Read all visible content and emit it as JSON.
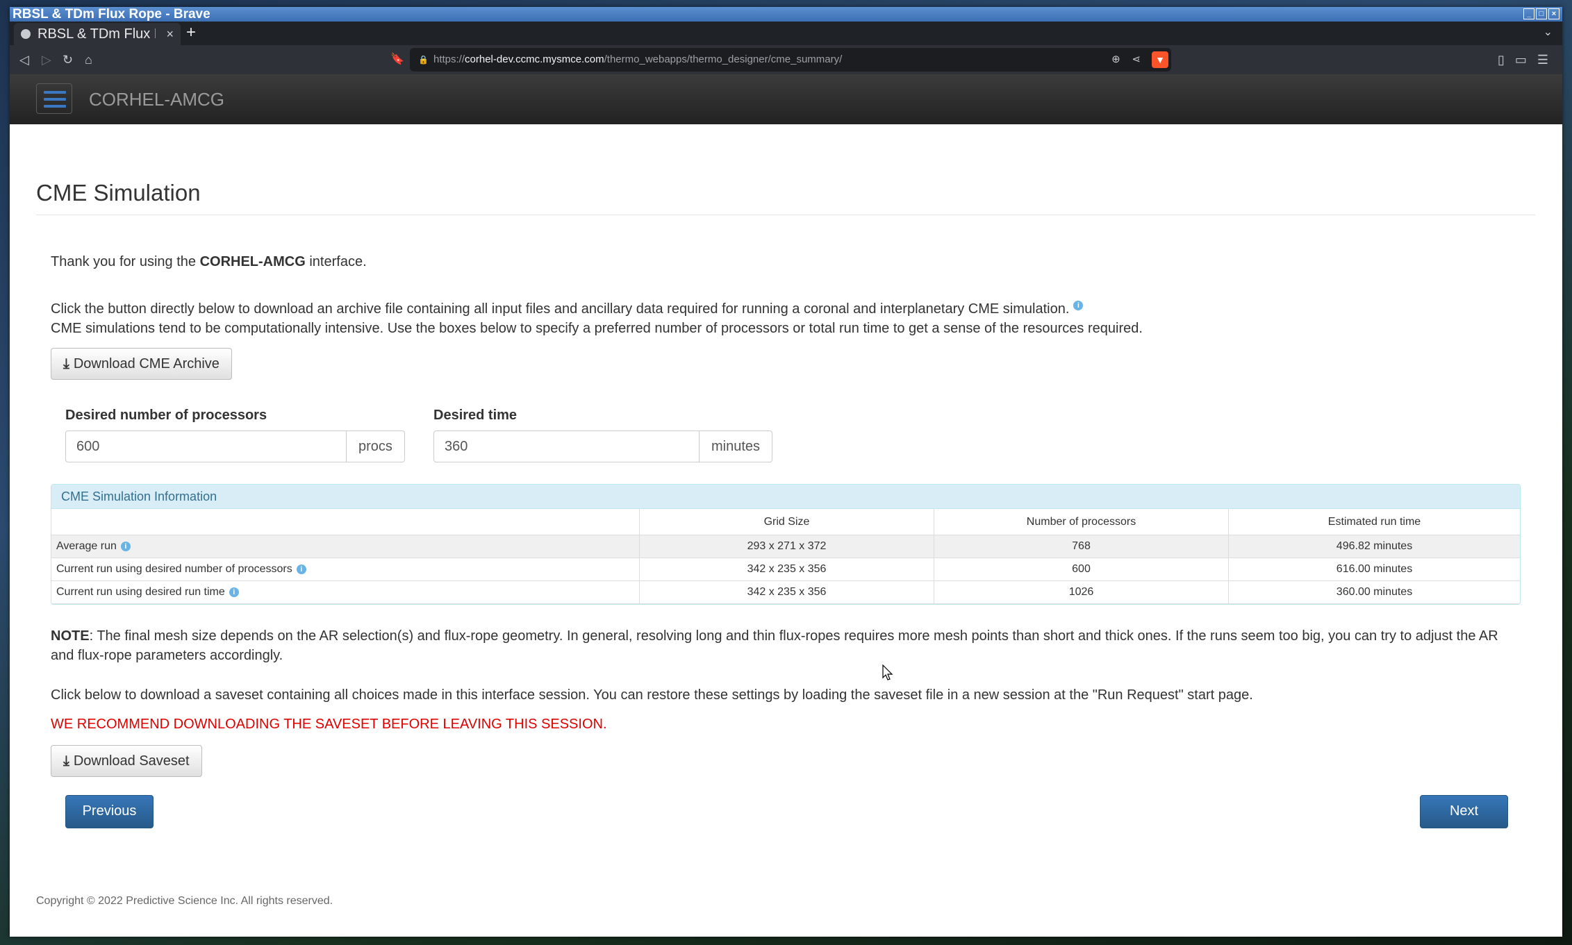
{
  "window": {
    "title": "RBSL & TDm Flux Rope - Brave"
  },
  "tab": {
    "label": "RBSL & TDm Flux Rope"
  },
  "url": {
    "host": "corhel-dev.ccmc.mysmce.com",
    "path": "/thermo_webapps/thermo_designer/cme_summary/",
    "scheme": "https://"
  },
  "navbar": {
    "brand": "CORHEL-AMCG"
  },
  "page": {
    "title": "CME Simulation",
    "thanks_pre": "Thank you for using the ",
    "thanks_bold": "CORHEL-AMCG",
    "thanks_post": " interface.",
    "intro1": "Click the button directly below to download an archive file containing all input files and ancillary data required for running a coronal and interplanetary CME simulation.",
    "intro2": "CME simulations tend to be computationally intensive. Use the boxes below to specify a preferred number of processors or total run time to get a sense of the resources required.",
    "download_archive": "Download CME Archive",
    "procs_label": "Desired number of processors",
    "procs_value": "600",
    "procs_unit": "procs",
    "time_label": "Desired time",
    "time_value": "360",
    "time_unit": "minutes",
    "note_bold": "NOTE",
    "note_text": ": The final mesh size depends on the AR selection(s) and flux-rope geometry. In general, resolving long and thin flux-ropes requires more mesh points than short and thick ones. If the runs seem too big, you can try to adjust the AR and flux-rope parameters accordingly.",
    "saveset_text": "Click below to download a saveset containing all choices made in this interface session. You can restore these settings by loading the saveset file in a new session at the \"Run Request\" start page.",
    "warning": "WE RECOMMEND DOWNLOADING THE SAVESET BEFORE LEAVING THIS SESSION.",
    "download_saveset": "Download Saveset",
    "previous": "Previous",
    "next": "Next",
    "footer": "Copyright © 2022 Predictive Science Inc. All rights reserved."
  },
  "info_panel": {
    "heading": "CME Simulation Information",
    "columns": [
      "",
      "Grid Size",
      "Number of processors",
      "Estimated run time"
    ],
    "rows": [
      {
        "label": "Average run",
        "grid": "293 x 271 x 372",
        "procs": "768",
        "time": "496.82 minutes"
      },
      {
        "label": "Current run using desired number of processors",
        "grid": "342 x 235 x 356",
        "procs": "600",
        "time": "616.00 minutes"
      },
      {
        "label": "Current run using desired run time",
        "grid": "342 x 235 x 356",
        "procs": "1026",
        "time": "360.00 minutes"
      }
    ]
  },
  "icons": {
    "info": "info-icon",
    "download": "download-icon",
    "menu": "hamburger-icon"
  }
}
